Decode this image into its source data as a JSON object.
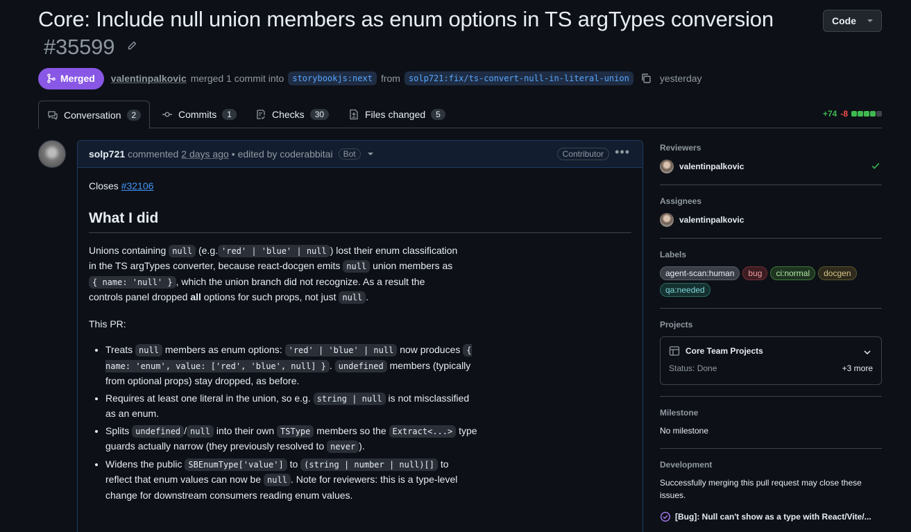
{
  "pr": {
    "title": "Core: Include null union members as enum options in TS argTypes conversion",
    "number": "#35599",
    "code_button": "Code",
    "status": "Merged",
    "merged_by": "valentinpalkovic",
    "merged_text": "merged 1 commit into",
    "base_branch": "storybookjs:next",
    "from_text": "from",
    "head_branch": "solp721:fix/ts-convert-null-in-literal-union",
    "when": "yesterday"
  },
  "tabs": [
    {
      "label": "Conversation",
      "count": "2"
    },
    {
      "label": "Commits",
      "count": "1"
    },
    {
      "label": "Checks",
      "count": "30"
    },
    {
      "label": "Files changed",
      "count": "5"
    }
  ],
  "diffstat": {
    "additions": "+74",
    "deletions": "-8",
    "colors": [
      "#3fb950",
      "#3fb950",
      "#3fb950",
      "#3fb950",
      "#3d444d"
    ]
  },
  "comment": {
    "author": "solp721",
    "verb": "commented",
    "time": "2 days ago",
    "edited": "• edited by coderabbitai",
    "bot_badge": "Bot",
    "role": "Contributor",
    "closes_prefix": "Closes",
    "closes_link": "#32106",
    "heading": "What I did",
    "p1": {
      "a": "Unions containing",
      "c1": "null",
      "b": "(e.g.",
      "c2": "'red' | 'blue' | null",
      "c": ") lost their enum classification in the TS argTypes converter, because react-docgen emits",
      "c3": "null",
      "d": "union members as",
      "c4": "{ name: 'null' }",
      "e": ", which the union branch did not recognize. As a result the controls panel dropped",
      "strong": "all",
      "f": "options for such props, not just",
      "c5": "null",
      "g": "."
    },
    "this_pr": "This PR:",
    "bullets": {
      "b1": {
        "a": "Treats",
        "c1": "null",
        "b": "members as enum options:",
        "c2": "'red' | 'blue' | null",
        "c": "now produces",
        "c3": "{ name: 'enum', value: ['red', 'blue', null] }",
        "d": ".",
        "c4": "undefined",
        "e": "members (typically from optional props) stay dropped, as before."
      },
      "b2": {
        "a": "Requires at least one literal in the union, so e.g.",
        "c1": "string | null",
        "b": "is not misclassified as an enum."
      },
      "b3": {
        "a": "Splits",
        "c1": "undefined",
        "b": "/",
        "c2": "null",
        "c": "into their own",
        "c3": "TSType",
        "d": "members so the",
        "c4": "Extract<...>",
        "e": "type guards actually narrow (they previously resolved to",
        "c5": "never",
        "f": ")."
      },
      "b4": {
        "a": "Widens the public",
        "c1": "SBEnumType['value']",
        "b": "to",
        "c2": "(string | number | null)[]",
        "c": "to reflect that enum values can now be",
        "c3": "null",
        "d": ". Note for reviewers: this is a type-level change for downstream consumers reading enum values."
      }
    }
  },
  "sidebar": {
    "reviewers_title": "Reviewers",
    "reviewer": "valentinpalkovic",
    "assignees_title": "Assignees",
    "assignee": "valentinpalkovic",
    "labels_title": "Labels",
    "labels": [
      {
        "text": "agent-scan:human",
        "fg": "#e6edf3",
        "bg": "#3a3f47",
        "border": "#5a6069"
      },
      {
        "text": "bug",
        "fg": "#f09ea0",
        "bg": "#3b1d22",
        "border": "#7a2d35"
      },
      {
        "text": "ci:normal",
        "fg": "#b5e8a6",
        "bg": "#1e3320",
        "border": "#3f7a3a"
      },
      {
        "text": "docgen",
        "fg": "#d9c58a",
        "bg": "#2e2a1c",
        "border": "#5e5630"
      },
      {
        "text": "qa:needed",
        "fg": "#7fd9d9",
        "bg": "#14302f",
        "border": "#2b6a67"
      }
    ],
    "projects_title": "Projects",
    "project_name": "Core Team Projects",
    "project_status": "Status: Done",
    "project_more": "+3 more",
    "milestone_title": "Milestone",
    "milestone": "No milestone",
    "development_title": "Development",
    "development_text": "Successfully merging this pull request may close these issues.",
    "linked_issue": "[Bug]: Null can't show as a type with React/Vite/..."
  }
}
